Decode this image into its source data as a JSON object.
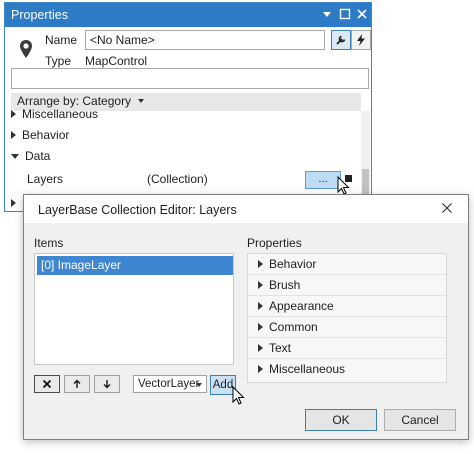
{
  "properties": {
    "title": "Properties",
    "name_label": "Name",
    "name_value": "<No Name>",
    "type_label": "Type",
    "type_value": "MapControl",
    "search_value": "",
    "arrange_label": "Arrange by: Category",
    "categories": {
      "miscellaneous": "Miscellaneous",
      "behavior": "Behavior",
      "data": "Data"
    },
    "layers_label": "Layers",
    "layers_value": "(Collection)",
    "ellipsis_label": "..."
  },
  "editor": {
    "title": "LayerBase Collection Editor: Layers",
    "items_label": "Items",
    "properties_label": "Properties",
    "items": [
      "[0] ImageLayer"
    ],
    "layer_type": "VectorLayer",
    "add_label": "Add",
    "property_groups": [
      "Behavior",
      "Brush",
      "Appearance",
      "Common",
      "Text",
      "Miscellaneous"
    ],
    "ok_label": "OK",
    "cancel_label": "Cancel"
  },
  "colors": {
    "title_bar": "#2d7bc6",
    "selection": "#3f86d1",
    "button_highlight": "#bcdcf4"
  }
}
